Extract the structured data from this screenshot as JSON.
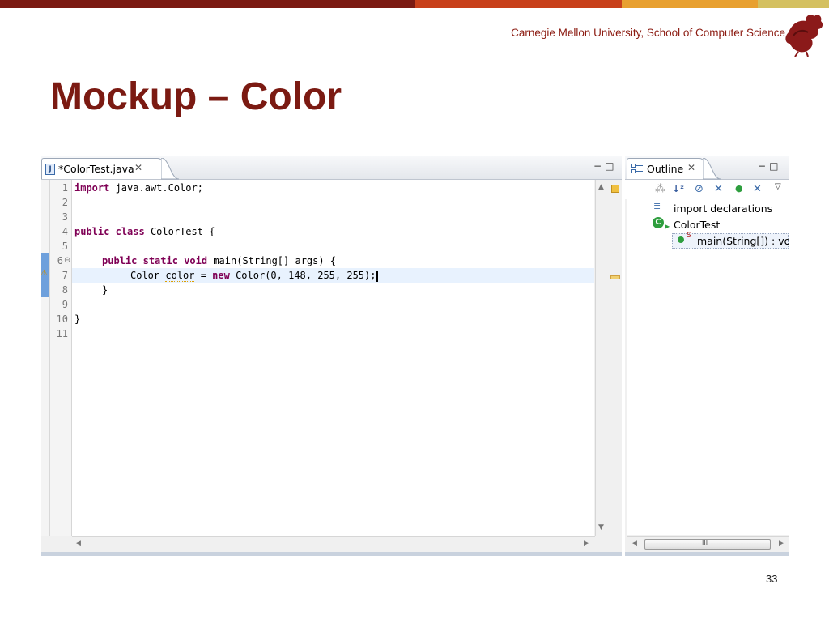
{
  "brand": {
    "affiliation": "Carnegie Mellon University, School of Computer Science",
    "stripe_colors": [
      "#7b1a12",
      "#c8401a",
      "#e8a030",
      "#d4c060",
      "#e0e0c0"
    ]
  },
  "slide": {
    "title": "Mockup – Color",
    "page_number": "33"
  },
  "editor": {
    "tab_label": "*ColorTest.java",
    "tab_icon": "java-file-icon",
    "minimize_label": "−",
    "maximize_label": "□",
    "close_label": "✕",
    "line_numbers": [
      "1",
      "2",
      "3",
      "4",
      "5",
      "6",
      "7",
      "8",
      "9",
      "10",
      "11"
    ],
    "code": {
      "l1_kw": "import",
      "l1_rest": " java.awt.Color;",
      "l4_kw1": "public",
      "l4_kw2": "class",
      "l4_rest": " ColorTest {",
      "l6_kw1": "public",
      "l6_kw2": "static",
      "l6_kw3": "void",
      "l6_rest": " main(String[] args) {",
      "l7_type": "Color ",
      "l7_var": "color",
      "l7_mid": " = ",
      "l7_kw": "new",
      "l7_rest": " Color(0, 148, 255, 255);",
      "l8": "}",
      "l10": "}"
    },
    "fold_marker": "⊖",
    "warning_marker": "warning-icon"
  },
  "outline": {
    "tab_label": "Outline",
    "tab_icon": "outline-icon",
    "toolbar_icons": [
      "focus-icon",
      "sort-az-icon",
      "hide-fields-icon",
      "hide-static-icon",
      "hide-nonpublic-icon",
      "hide-local-types-icon",
      "view-menu-icon"
    ],
    "items": [
      {
        "label": "import declarations",
        "icon": "imports-icon"
      },
      {
        "label": "ColorTest",
        "icon": "class-icon"
      },
      {
        "label": "main(String[]) : void",
        "icon": "public-method-icon",
        "modifier": "S"
      }
    ],
    "scroll_thumb_label": "III"
  }
}
